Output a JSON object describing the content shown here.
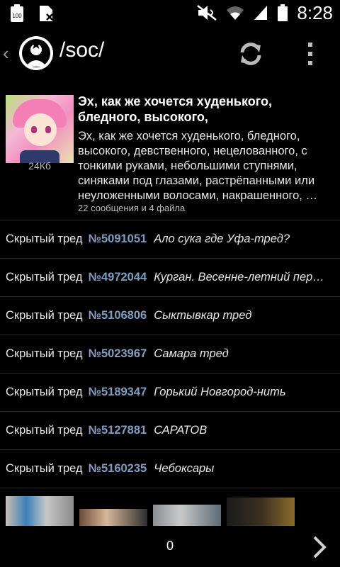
{
  "status_bar": {
    "time": "8:28",
    "battery_badge": "100",
    "icons": [
      "battery-100-icon",
      "sim-icon",
      "mute-icon",
      "wifi-icon",
      "signal-icon",
      "battery-icon"
    ]
  },
  "action_bar": {
    "title": "/soc/",
    "icons": [
      "back-chevron-icon",
      "anonymous-logo-icon",
      "refresh-icon",
      "overflow-menu-icon"
    ]
  },
  "featured_thread": {
    "subject": "Эх, как же хочется худенького, бледного, высокого,",
    "body": "Эх, как же хочется худенького, бледного, высокого, девственного, нецелованного, с тонкими руками, небольшими ступнями, синяками под глазами, растрёпанными или неуложенными волосами, накрашенного, …",
    "file_size": "24Кб",
    "meta": "22 сообщения и 4 файла"
  },
  "hidden_threads": [
    {
      "label": "Скрытый тред",
      "number": "№5091051",
      "subject": "Ало сука где Уфа-тред?"
    },
    {
      "label": "Скрытый тред",
      "number": "№4972044",
      "subject": "Курган. Весенне-летний перека..."
    },
    {
      "label": "Скрытый тред",
      "number": "№5106806",
      "subject": "Сыктывкар тред"
    },
    {
      "label": "Скрытый тред",
      "number": "№5023967",
      "subject": "Самара тред"
    },
    {
      "label": "Скрытый тред",
      "number": "№5189347",
      "subject": "Горький Новгород-нить"
    },
    {
      "label": "Скрытый тред",
      "number": "№5127881",
      "subject": "САРАТОВ"
    },
    {
      "label": "Скрытый тред",
      "number": "№5160235",
      "subject": "Чебоксары"
    }
  ],
  "bottom_bar": {
    "page": "0",
    "next_icon": "chevron-right-icon"
  },
  "colors": {
    "background": "#000000",
    "thread_number": "#7e9dc0",
    "divider": "#2a2a2a",
    "secondary_text": "#bdbdbd"
  }
}
